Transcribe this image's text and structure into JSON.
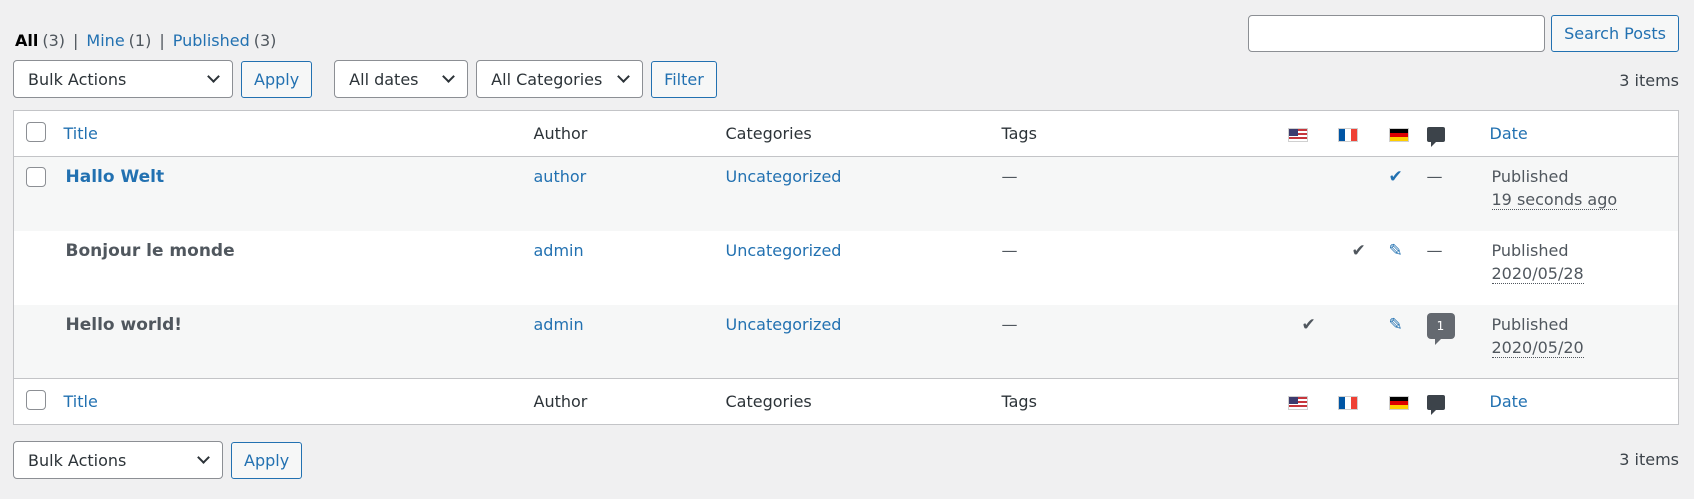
{
  "views": {
    "all": {
      "label": "All",
      "count": "(3)"
    },
    "mine": {
      "label": "Mine",
      "count": "(1)"
    },
    "published": {
      "label": "Published",
      "count": "(3)"
    },
    "separator": "|"
  },
  "search": {
    "value": "",
    "button": "Search Posts"
  },
  "top_nav": {
    "bulk_actions": "Bulk Actions",
    "apply": "Apply",
    "dates": "All dates",
    "categories": "All Categories",
    "filter": "Filter",
    "items": "3 items"
  },
  "bottom_nav": {
    "bulk_actions": "Bulk Actions",
    "apply": "Apply",
    "items": "3 items"
  },
  "columns": {
    "title": "Title",
    "author": "Author",
    "categories": "Categories",
    "tags": "Tags",
    "date": "Date",
    "lang_icons": [
      "us-flag-icon",
      "fr-flag-icon",
      "de-flag-icon"
    ],
    "comments_icon": "comment-bubble-icon"
  },
  "rows": [
    {
      "title": "Hallo Welt",
      "author": "author",
      "category": "Uncategorized",
      "tags": "—",
      "en": "",
      "fr": "",
      "de": "✔",
      "comments": "—",
      "status": "Published",
      "date": "19 seconds ago"
    },
    {
      "title": "Bonjour le monde",
      "author": "admin",
      "category": "Uncategorized",
      "tags": "—",
      "en": "",
      "fr": "✔",
      "de": "✎",
      "comments": "—",
      "status": "Published",
      "date": "2020/05/28"
    },
    {
      "title": "Hello world!",
      "author": "admin",
      "category": "Uncategorized",
      "tags": "—",
      "en": "✔",
      "fr": "",
      "de": "✎",
      "comments": "1",
      "status": "Published",
      "date": "2020/05/20"
    }
  ],
  "colors": {
    "link": "#2271b1",
    "bg": "#f0f0f1",
    "border": "#c3c4c7"
  }
}
